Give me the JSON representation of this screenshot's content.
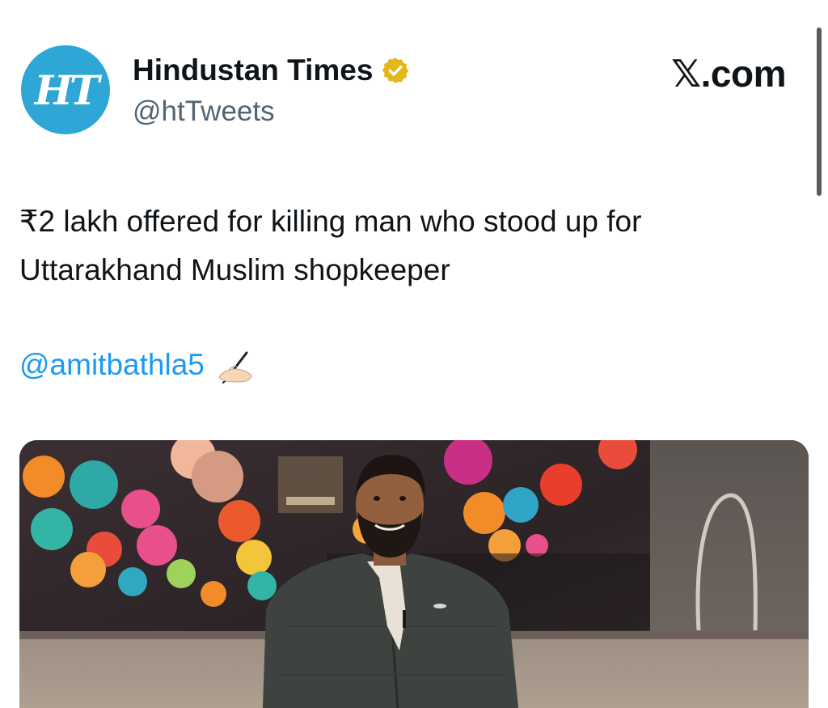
{
  "account": {
    "display_name": "Hindustan Times",
    "handle": "@htTweets",
    "avatar_text": "HT",
    "avatar_color": "#2ea6d6",
    "verified_icon": "verified-badge-icon"
  },
  "brand": {
    "label": ".com",
    "x_glyph": "𝕏"
  },
  "tweet": {
    "text": "₹2 lakh offered for killing man who stood up for Uttarakhand Muslim shopkeeper",
    "mention": "@amitbathla5",
    "mention_emoji_icon": "writing-hand-icon"
  },
  "media": {
    "icon": "photo-icon"
  },
  "colors": {
    "link": "#1d9bf0",
    "secondary_text": "#536471",
    "verified_gold": "#e2b719"
  }
}
